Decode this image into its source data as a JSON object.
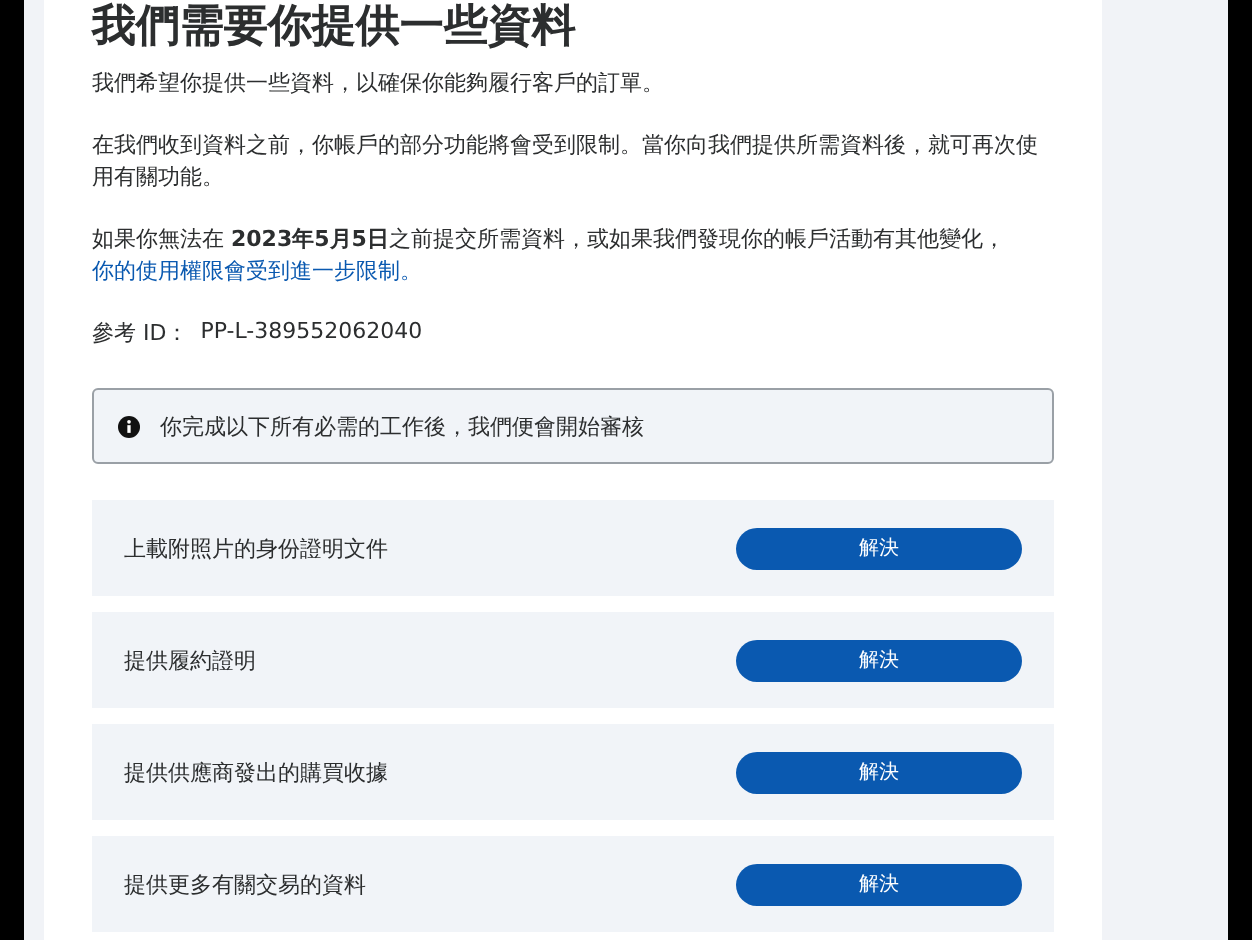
{
  "title": "我們需要你提供一些資料",
  "paragraphs": [
    "我們希望你提供一些資料，以確保你能夠履行客戶的訂單。",
    "在我們收到資料之前，你帳戶的部分功能將會受到限制。當你向我們提供所需資料後，就可再次使用有關功能。"
  ],
  "warning": {
    "text": "如果你無法在 **2023年5月5日**之前提交所需資料，或如果我們發現你的帳戶活動有其他變化，",
    "link": "你的使用權限會受到進一步限制。"
  },
  "reference": {
    "label": "參考 ID：",
    "value": "PP-L-389552062040"
  },
  "notice": "你完成以下所有必需的工作後，我們便會開始審核",
  "tasks": [
    {
      "label": "上載附照片的身份證明文件",
      "action": "解決"
    },
    {
      "label": "提供履約證明",
      "action": "解決"
    },
    {
      "label": "提供供應商發出的購買收據",
      "action": "解決"
    },
    {
      "label": "提供更多有關交易的資料",
      "action": "解決"
    }
  ]
}
